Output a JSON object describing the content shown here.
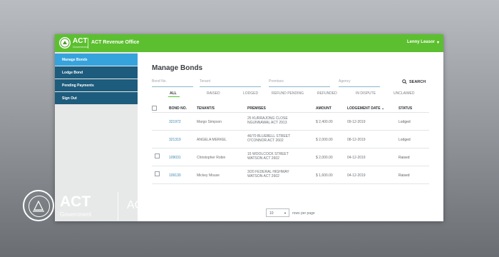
{
  "header": {
    "logo_text": "ACT",
    "logo_sub": "Government",
    "app_title": "ACT Revenue Office",
    "user_name": "Lenny Leasor",
    "user_caret": "▾"
  },
  "sidebar": {
    "items": [
      {
        "label": "Manage Bonds"
      },
      {
        "label": "Lodge Bond"
      },
      {
        "label": "Pending Payments"
      },
      {
        "label": "Sign Out"
      }
    ]
  },
  "main": {
    "title": "Manage Bonds",
    "filters": {
      "bond_no": "Bond No.",
      "tenant": "Tenant",
      "premises": "Premises",
      "agency": "Agency"
    },
    "search_label": "SEARCH",
    "tabs": [
      "ALL",
      "RAISED",
      "LODGED",
      "REFUND PENDING",
      "REFUNDED",
      "IN DISPUTE",
      "UNCLAIMED"
    ],
    "columns": [
      "BOND NO.",
      "TENANT/S",
      "PREMISES",
      "AMOUNT",
      "LODGEMENT DATE",
      "STATUS"
    ],
    "sort_icon": "⌄",
    "rows": [
      {
        "bond": "321972",
        "tenant": "Margo Simpson",
        "premises": [
          "25 KURRAJONG CLOSE",
          "NGUNNAWAL ACT 2913"
        ],
        "amount": "$ 2,400.00",
        "date": "09-12-2019",
        "status": "Lodged",
        "checkbox": false
      },
      {
        "bond": "321319",
        "tenant": "ANGELA MERKEL",
        "premises": [
          "46/70 BLUEBELL STREET",
          "O'CONNOR ACT 2602"
        ],
        "amount": "$ 2,000.00",
        "date": "08-12-2019",
        "status": "Lodged",
        "checkbox": false
      },
      {
        "bond": "109031",
        "tenant": "Christopher Robin",
        "premises": [
          "15 WOOLCOCK STREET",
          "WATSON ACT 2602"
        ],
        "amount": "$ 2,000.00",
        "date": "04-12-2019",
        "status": "Raised",
        "checkbox": true
      },
      {
        "bond": "109130",
        "tenant": "Mickey Mouse",
        "premises": [
          "3/20 FEDERAL HIGHWAY",
          "WATSON ACT 2602"
        ],
        "amount": "$ 1,600.00",
        "date": "04-12-2019",
        "status": "Raised",
        "checkbox": true
      }
    ],
    "pager": {
      "value": "10",
      "label": "rows per page"
    }
  },
  "brand": {
    "act": "ACT",
    "government": "Government",
    "office": "ACT Revenue Office"
  },
  "colors": {
    "accent_green": "#5cbf2f",
    "nav_blue": "#1d5c7c",
    "nav_active": "#36a3dc",
    "link_blue": "#3a86b0"
  }
}
